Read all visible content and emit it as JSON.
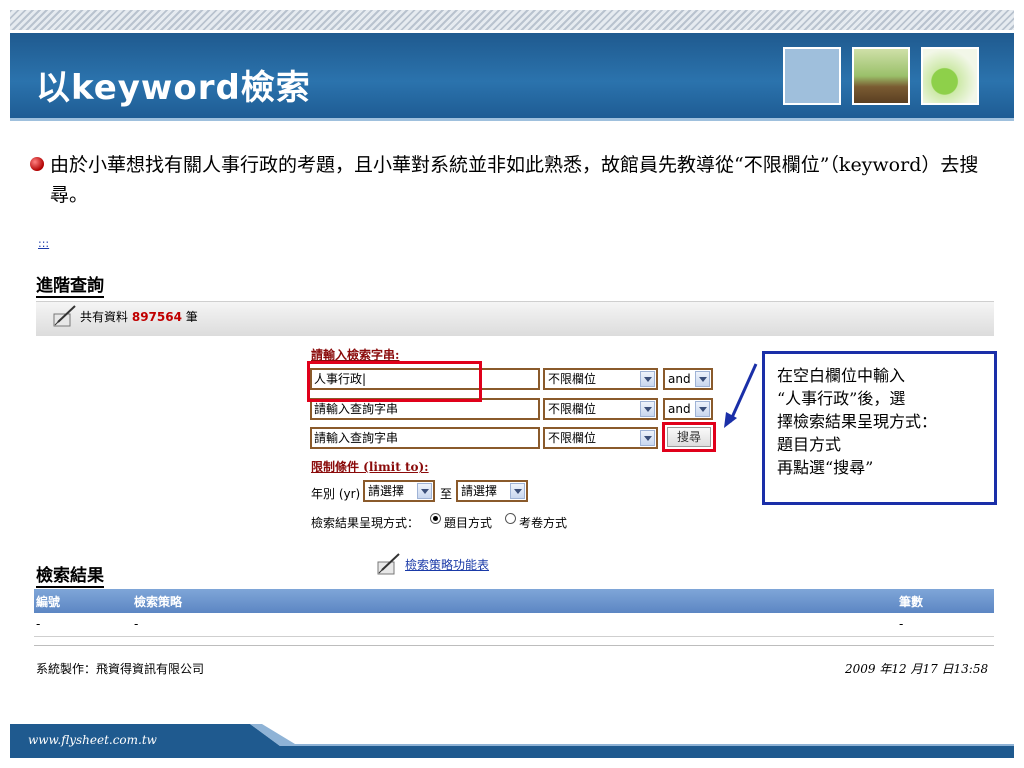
{
  "slide": {
    "title": "以keyword檢索",
    "bullet": "由於小華想找有關人事行政的考題，且小華對系統並非如此熟悉，故館員先教導從“不限欄位”（keyword）去搜尋。",
    "footer_url": "www.flysheet.com.tw"
  },
  "screenshot": {
    "nav_dots": ":::",
    "advanced_heading": "進階查詢",
    "record_count_prefix": "共有資料",
    "record_count": "897564",
    "record_count_suffix": "筆",
    "input_label": "請輸入檢索字串:",
    "rows": [
      {
        "query": "人事行政|",
        "field": "不限欄位",
        "op": "and"
      },
      {
        "query": "請輸入查詢字串",
        "field": "不限欄位",
        "op": "and"
      },
      {
        "query": "請輸入查詢字串",
        "field": "不限欄位"
      }
    ],
    "search_button": "搜尋",
    "limit_label": "限制條件 (limit to):",
    "year_label": "年別 (yr)",
    "year_from": "請選擇",
    "year_to_label": "至",
    "year_to": "請選擇",
    "display_label": "檢索結果呈現方式：",
    "display_option_title": "題目方式",
    "display_option_paper": "考卷方式",
    "results_heading": "檢索結果",
    "strategy_link": "檢索策略功能表",
    "table_headers": [
      "編號",
      "檢索策略",
      "筆數"
    ],
    "table_row": [
      "-",
      "-",
      "-"
    ],
    "footer_credit": "系統製作：飛資得資訊有限公司",
    "footer_time": "2009 年12 月17 日13:58"
  },
  "callout": {
    "lines": [
      "在空白欄位中輸入",
      "“人事行政”後，選",
      "擇檢索結果呈現方式：",
      "題目方式",
      "再點選“搜尋”"
    ]
  },
  "colors": {
    "title_bar": "#2b73ad",
    "highlight_red": "#e0001a",
    "callout_border": "#1a2fa8",
    "table_header": "#6a92cb"
  }
}
